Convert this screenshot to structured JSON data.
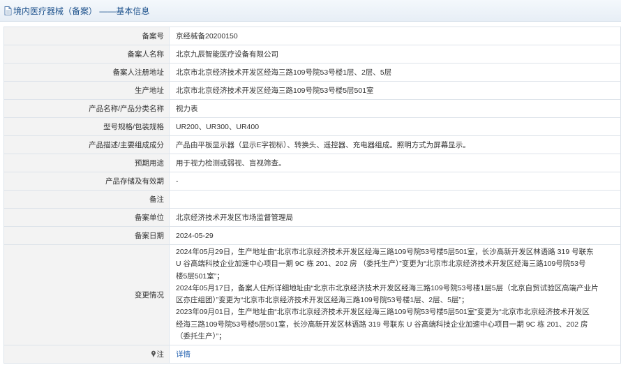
{
  "header": {
    "title": "境内医疗器械（备案） ——基本信息"
  },
  "rows": [
    {
      "label": "备案号",
      "value": "京经械备20200150"
    },
    {
      "label": "备案人名称",
      "value": "北京九辰智能医疗设备有限公司"
    },
    {
      "label": "备案人注册地址",
      "value": "北京市北京经济技术开发区经海三路109号院53号楼1层、2层、5层"
    },
    {
      "label": "生产地址",
      "value": "北京市北京经济技术开发区经海三路109号院53号楼5层501室"
    },
    {
      "label": "产品名称/产品分类名称",
      "value": "视力表"
    },
    {
      "label": "型号规格/包装规格",
      "value": "UR200、UR300、UR400"
    },
    {
      "label": "产品描述/主要组成成分",
      "value": "产品由平板显示器（显示E字视标）、转换头、遥控器、充电器组成。照明方式为屏幕显示。"
    },
    {
      "label": "预期用途",
      "value": "用于视力检测或弱视、盲视筛查。"
    },
    {
      "label": "产品存储及有效期",
      "value": "-"
    },
    {
      "label": "备注",
      "value": ""
    },
    {
      "label": "备案单位",
      "value": "北京经济技术开发区市场监督管理局"
    },
    {
      "label": "备案日期",
      "value": "2024-05-29"
    }
  ],
  "changes": {
    "label": "变更情况",
    "lines": [
      "2024年05月29日，生产地址由“北京市北京经济技术开发区经海三路109号院53号楼5层501室，长沙高新开发区林语路 319 号联东",
      "U 谷高端科技企业加速中心项目一期 9C 栋 201、202 房 （委托生产）”变更为“北京市北京经济技术开发区经海三路109号院53号",
      "楼5层501室”；",
      "2024年05月17日，备案人住所详细地址由“北京市北京经济技术开发区经海三路109号院53号楼1层5层（北京自贸试验区高端产业片",
      "区亦庄组团）”变更为“北京市北京经济技术开发区经海三路109号院53号楼1层、2层、5层”；",
      "2023年09月01日，生产地址由“北京市北京经济技术开发区经海三路109号院53号楼5层501室”变更为“北京市北京经济技术开发区",
      "经海三路109号院53号楼5层501室，长沙高新开发区林语路 319 号联东 U 谷高端科技企业加速中心项目一期 9C 栋 201、202 房",
      "（委托生产）”；"
    ]
  },
  "note": {
    "icon": "pin-icon",
    "label": "注",
    "link": "详情"
  }
}
